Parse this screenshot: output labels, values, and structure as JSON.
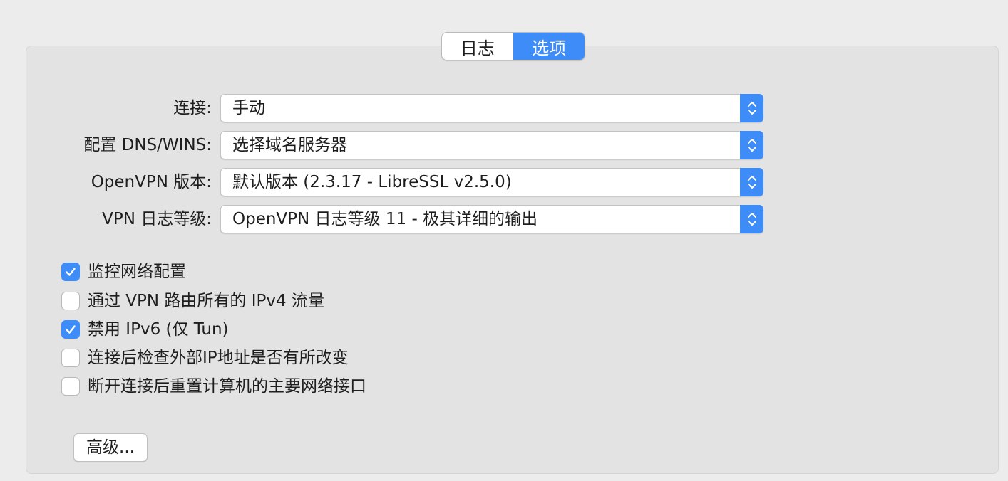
{
  "tabs": [
    {
      "label": "日志",
      "active": false
    },
    {
      "label": "选项",
      "active": true
    }
  ],
  "settings": [
    {
      "label": "连接:",
      "value": "手动"
    },
    {
      "label": "配置 DNS/WINS:",
      "value": "选择域名服务器"
    },
    {
      "label": "OpenVPN 版本:",
      "value": "默认版本 (2.3.17 - LibreSSL v2.5.0)"
    },
    {
      "label": "VPN 日志等级:",
      "value": "OpenVPN 日志等级 11 - 极其详细的输出"
    }
  ],
  "checkboxes": [
    {
      "label": "监控网络配置",
      "checked": true
    },
    {
      "label": "通过 VPN 路由所有的 IPv4 流量",
      "checked": false
    },
    {
      "label": "禁用 IPv6 (仅 Tun)",
      "checked": true
    },
    {
      "label": "连接后检查外部IP地址是否有所改变",
      "checked": false
    },
    {
      "label": "断开连接后重置计算机的主要网络接口",
      "checked": false
    }
  ],
  "advanced_button": {
    "label": "高级..."
  },
  "colors": {
    "accent": "#3e8cf7",
    "window_bg": "#ececec",
    "panel_bg": "#e3e3e3"
  }
}
